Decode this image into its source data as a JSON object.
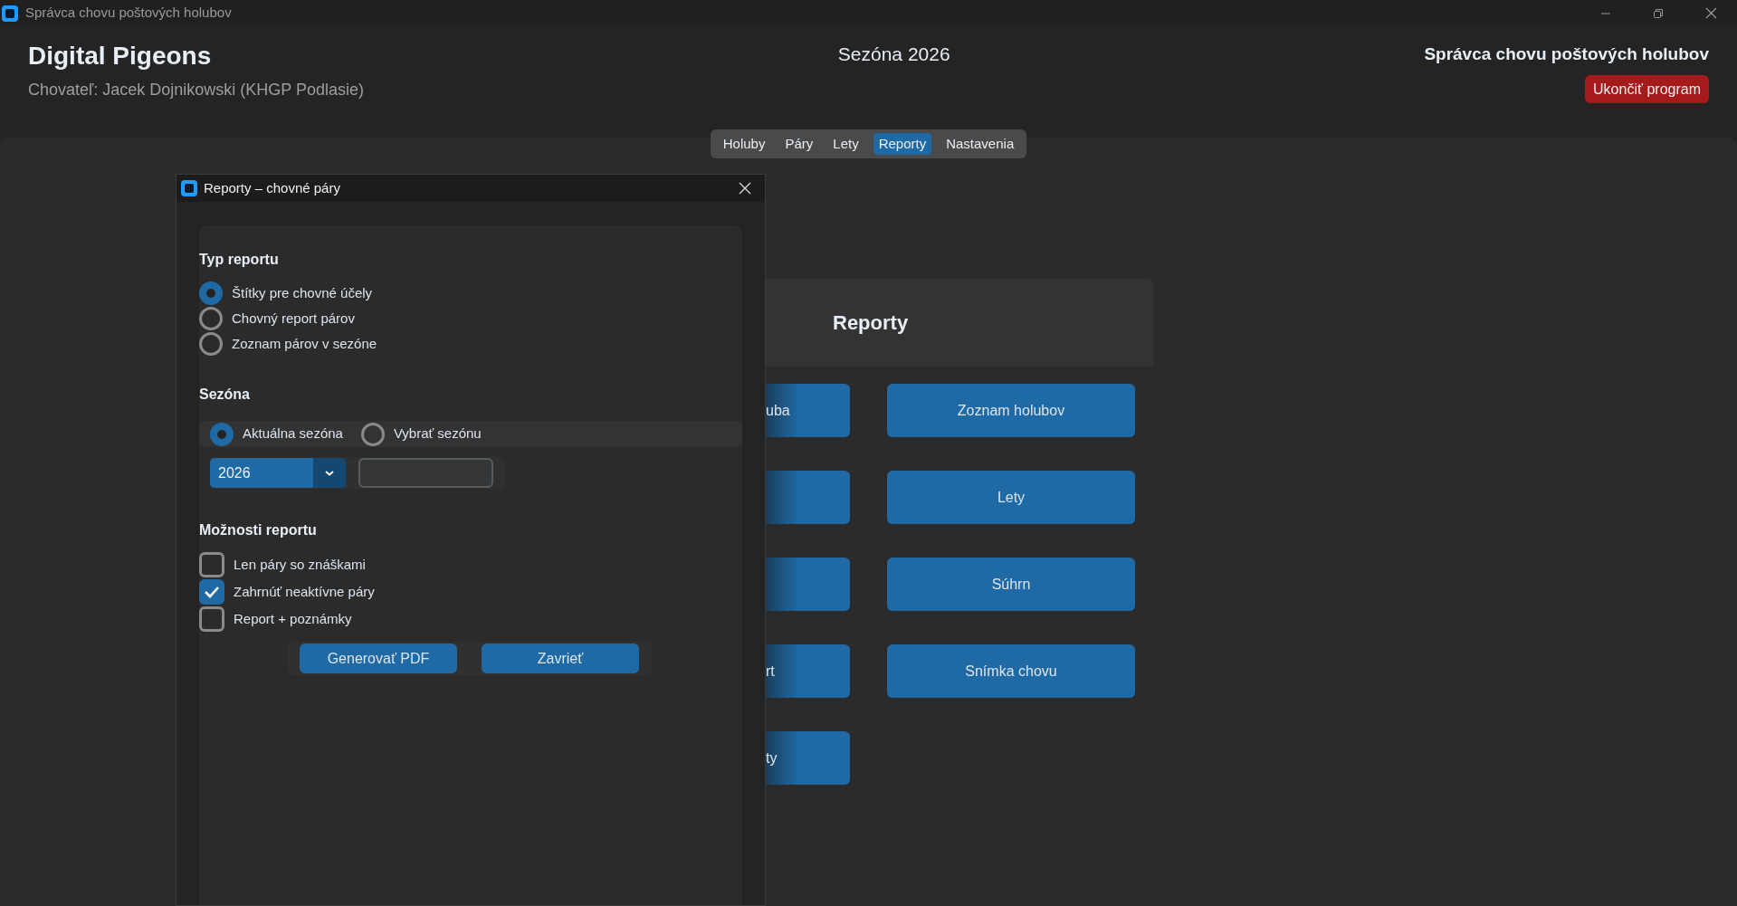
{
  "window": {
    "title": "Správca chovu poštových holubov"
  },
  "header": {
    "app_name": "Digital Pigeons",
    "breeder": "Chovateľ: Jacek Dojnikowski (KHGP Podlasie)",
    "season": "Sezóna 2026",
    "app_title": "Správca chovu poštových holubov",
    "exit_button": "Ukončiť program"
  },
  "tabs": [
    {
      "label": "Holuby",
      "selected": false
    },
    {
      "label": "Páry",
      "selected": false
    },
    {
      "label": "Lety",
      "selected": false
    },
    {
      "label": "Reporty",
      "selected": true
    },
    {
      "label": "Nastavenia",
      "selected": false
    }
  ],
  "reports_panel": {
    "title": "Reporty",
    "left_buttons": [
      {
        "kind": "text",
        "label": "uba"
      },
      {
        "kind": "plain"
      },
      {
        "kind": "plain"
      },
      {
        "kind": "text",
        "label": "rt"
      },
      {
        "kind": "text",
        "label": "ty"
      }
    ],
    "right_buttons": [
      {
        "label": "Zoznam holubov"
      },
      {
        "label": "Lety"
      },
      {
        "label": "Súhrn"
      },
      {
        "label": "Snímka chovu"
      }
    ]
  },
  "dialog": {
    "title": "Reporty – chovné páry",
    "report_type": {
      "heading": "Typ reportu",
      "options": [
        {
          "label": "Štítky pre chovné účely",
          "selected": true
        },
        {
          "label": "Chovný report párov",
          "selected": false
        },
        {
          "label": "Zoznam párov v sezóne",
          "selected": false
        }
      ]
    },
    "season": {
      "heading": "Sezóna",
      "modes": [
        {
          "label": "Aktuálna sezóna",
          "selected": true
        },
        {
          "label": "Vybrať sezónu",
          "selected": false
        }
      ],
      "year_dropdown": {
        "value": "2026"
      }
    },
    "options": {
      "heading": "Možnosti reportu",
      "items": [
        {
          "label": "Len páry so znáškami",
          "checked": false
        },
        {
          "label": "Zahrnúť neaktívne páry",
          "checked": true
        },
        {
          "label": "Report + poznámky",
          "checked": false
        }
      ]
    },
    "buttons": [
      {
        "label": "Generovať PDF"
      },
      {
        "label": "Zavrieť"
      }
    ]
  }
}
